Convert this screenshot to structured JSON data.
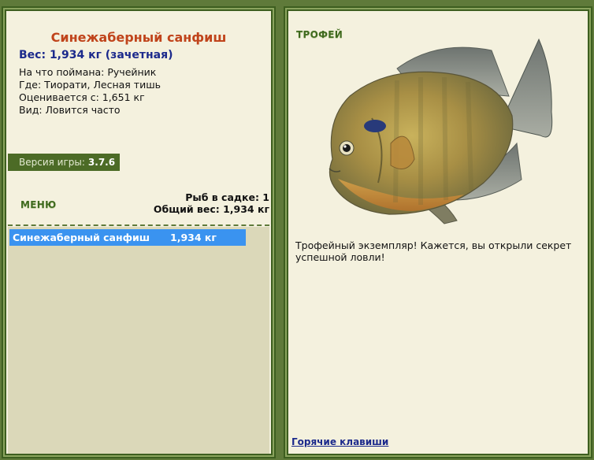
{
  "fish": {
    "title": "Синежаберный санфиш",
    "weight_line": "Вес: 1,934 кг (зачетная)",
    "caught_on": "На что поймана: Ручейник",
    "location": "Где: Тиорати, Лесная тишь",
    "valued_from": "Оценивается с: 1,651 кг",
    "frequency": "Вид: Ловится часто"
  },
  "version": {
    "label": "Версия игры:",
    "value": "3.7.6"
  },
  "menu": {
    "label": "МЕНЮ"
  },
  "stats": {
    "fish_in_net": "Рыб в садке: 1",
    "total_weight": "Общий вес: 1,934 кг"
  },
  "catch_list": [
    {
      "name": "Синежаберный санфиш",
      "weight": "1,934 кг"
    }
  ],
  "trophy": {
    "label": "ТРОФЕЙ",
    "text": "Трофейный экземпляр! Кажется, вы открыли секрет успешной ловли!"
  },
  "hotkeys_label": "Горячие клавиши",
  "colors": {
    "background": "#5f7a3a",
    "panel": "#f4f1de",
    "title": "#c0441b",
    "weight": "#1c2a8c",
    "selection": "#3a93f0"
  }
}
